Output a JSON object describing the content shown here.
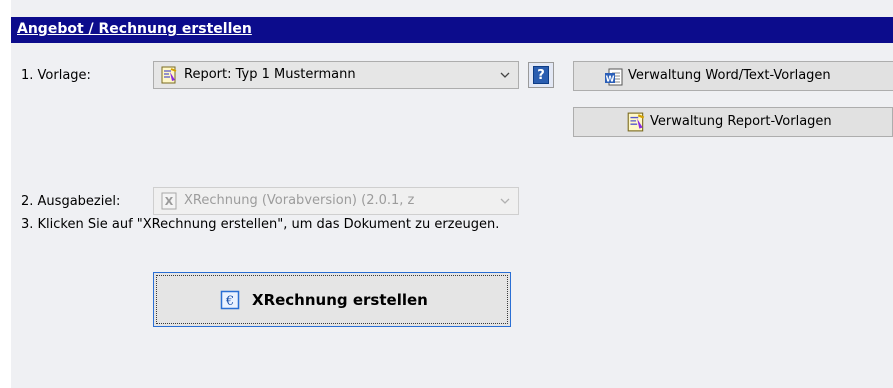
{
  "panel": {
    "title": "Angebot / Rechnung erstellen"
  },
  "step1": {
    "label": "1. Vorlage:",
    "template_select": {
      "value": "Report: Typ 1 Mustermann",
      "icon": "report-template-icon"
    },
    "help_button": {
      "label": "?"
    },
    "manage_word_button": {
      "label": "Verwaltung Word/Text-Vorlagen",
      "icon": "word-document-icon"
    },
    "manage_report_button": {
      "label": "Verwaltung Report-Vorlagen",
      "icon": "report-template-icon"
    }
  },
  "step2": {
    "label": "2. Ausgabeziel:",
    "target_select": {
      "value": "XRechnung (Vorabversion) (2.0.1, z",
      "icon": "xrechnung-icon",
      "disabled": true
    }
  },
  "step3": {
    "instruction": "3. Klicken Sie auf \"XRechnung erstellen\", um das Dokument zu erzeugen."
  },
  "create_button": {
    "label": "XRechnung erstellen",
    "icon": "euro-document-icon"
  },
  "colors": {
    "title_bar": "#0c0c8c",
    "panel_background": "#eff0f3",
    "focus_border": "#2a6fd4"
  }
}
